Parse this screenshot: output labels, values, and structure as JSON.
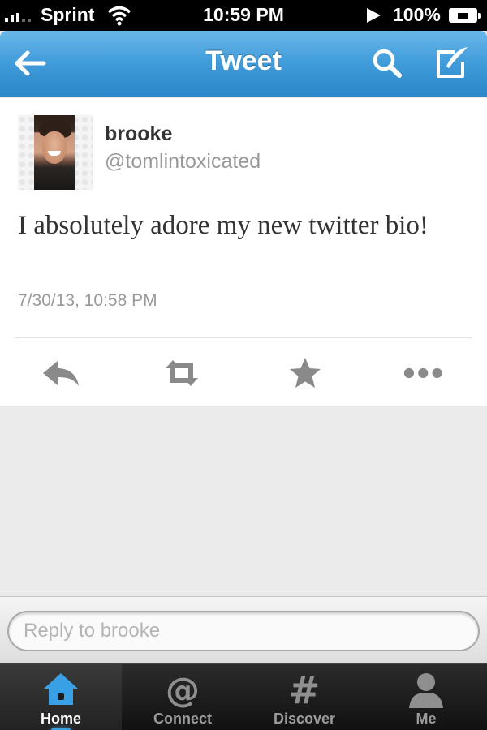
{
  "status_bar": {
    "carrier": "Sprint",
    "time": "10:59 PM",
    "battery": "100%"
  },
  "nav": {
    "title": "Tweet"
  },
  "tweet": {
    "user_name": "brooke",
    "user_handle": "@tomlintoxicated",
    "text": "I absolutely adore my new twitter bio!",
    "timestamp": "7/30/13, 10:58 PM"
  },
  "reply": {
    "placeholder": "Reply to brooke"
  },
  "tabs": [
    {
      "label": "Home",
      "icon": "home-icon",
      "active": true
    },
    {
      "label": "Connect",
      "icon": "at-icon",
      "active": false
    },
    {
      "label": "Discover",
      "icon": "hashtag-icon",
      "active": false
    },
    {
      "label": "Me",
      "icon": "person-icon",
      "active": false
    }
  ],
  "colors": {
    "nav_blue": "#3f9bd9",
    "tab_highlight": "#3aa0e6",
    "text_dark": "#333333",
    "text_muted": "#999999"
  }
}
